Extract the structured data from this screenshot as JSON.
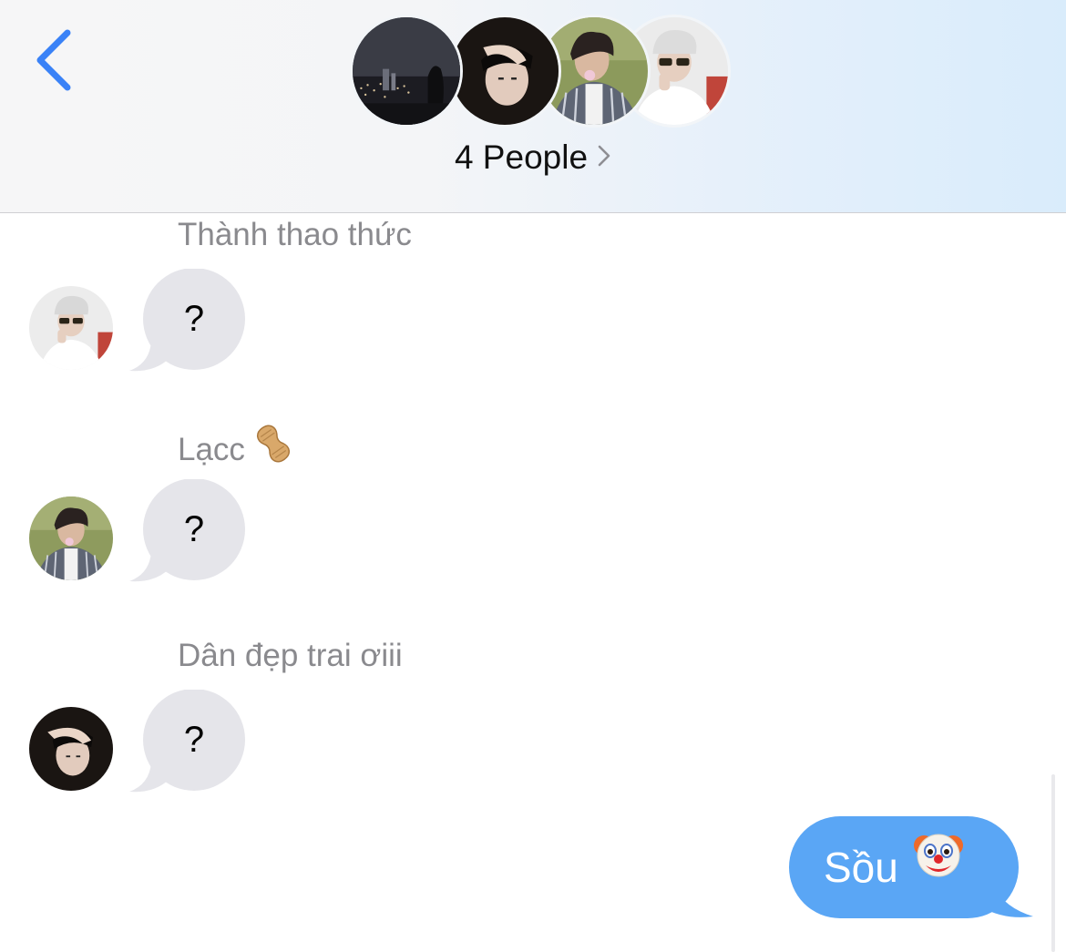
{
  "header": {
    "group_label": "4 People",
    "back_icon": "chevron-left-icon",
    "accent_color": "#3a82f7"
  },
  "messages": [
    {
      "sender": "Thành thao thức",
      "text": "?",
      "avatar": "avatar-white-cap-sunglasses"
    },
    {
      "sender": "Lạcc",
      "sender_emoji": "peanut-icon",
      "text": "?",
      "avatar": "avatar-striped-shirt"
    },
    {
      "sender": "Dân đẹp trai ơiii",
      "text": "?",
      "avatar": "avatar-dark-selfie"
    }
  ],
  "outgoing": {
    "text": "Sồu",
    "emoji": "clown-face-icon",
    "bubble_color": "#5aa6f5"
  },
  "incoming_bubble_color": "#e5e5ea"
}
